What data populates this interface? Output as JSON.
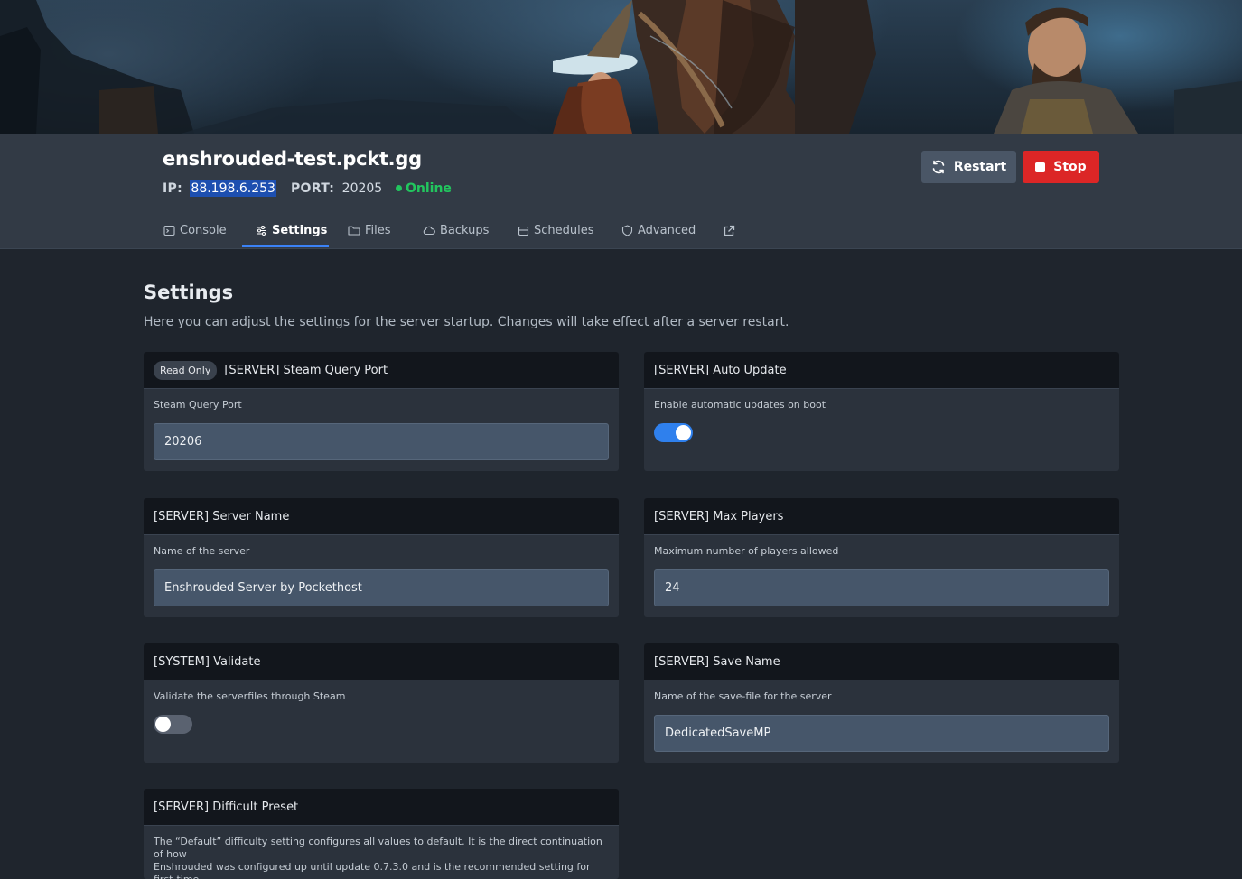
{
  "server": {
    "name": "enshrouded-test.pckt.gg",
    "ip_label": "IP:",
    "ip": "88.198.6.253",
    "port_label": "PORT:",
    "port": "20205",
    "status": "Online",
    "status_color": "#22c55e"
  },
  "actions": {
    "restart_label": "Restart",
    "stop_label": "Stop",
    "stop_color": "#dc2626"
  },
  "tabs": [
    {
      "label": "Console",
      "icon": "terminal-icon"
    },
    {
      "label": "Settings",
      "icon": "sliders-icon",
      "active": true
    },
    {
      "label": "Files",
      "icon": "folder-icon"
    },
    {
      "label": "Backups",
      "icon": "cloud-icon"
    },
    {
      "label": "Schedules",
      "icon": "calendar-icon"
    },
    {
      "label": "Advanced",
      "icon": "shield-icon"
    },
    {
      "label": "",
      "icon": "external-link-icon"
    }
  ],
  "page": {
    "title": "Settings",
    "description": "Here you can adjust the settings for the server startup. Changes will take effect after a server restart."
  },
  "settings": {
    "steam_query_port": {
      "badge": "Read Only",
      "title": "[SERVER] Steam Query Port",
      "description": "Steam Query Port",
      "value": "20206"
    },
    "auto_update": {
      "title": "[SERVER] Auto Update",
      "description": "Enable automatic updates on boot",
      "enabled": true
    },
    "server_name": {
      "title": "[SERVER] Server Name",
      "description": "Name of the server",
      "value": "Enshrouded Server by Pockethost"
    },
    "max_players": {
      "title": "[SERVER] Max Players",
      "description": "Maximum number of players allowed",
      "value": "24"
    },
    "validate": {
      "title": "[SYSTEM] Validate",
      "description": "Validate the serverfiles through Steam",
      "enabled": false
    },
    "save_name": {
      "title": "[SERVER] Save Name",
      "description": "Name of the save-file for the server",
      "value": "DedicatedSaveMP"
    },
    "difficult_preset": {
      "title": "[SERVER] Difficult Preset",
      "description_line1": "The “Default” difficulty setting configures all values to default. It is the direct continuation of how",
      "description_line2": "Enshrouded was configured up until update 0.7.3.0 and is the recommended setting for first-time"
    }
  },
  "colors": {
    "accent": "#3b82f6",
    "toggle_on": "#2f80ed"
  }
}
